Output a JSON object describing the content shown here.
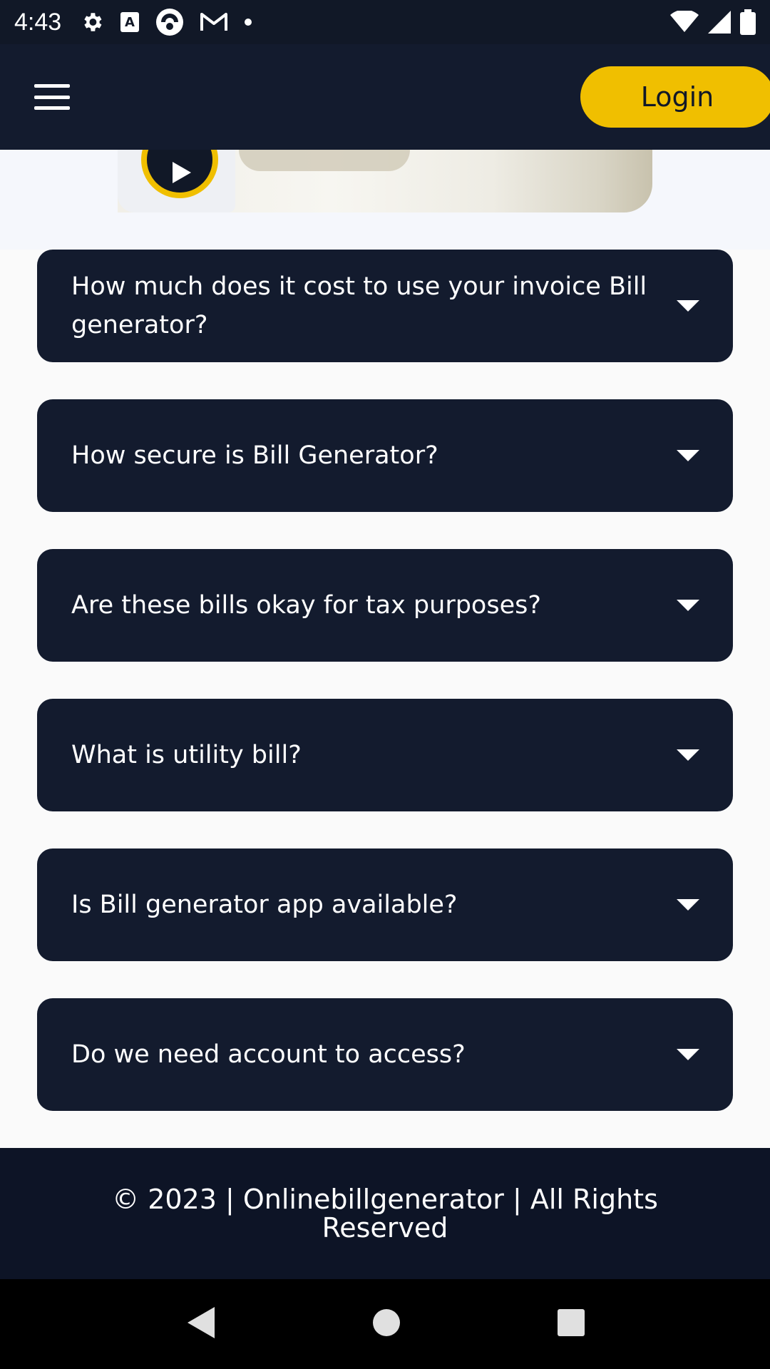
{
  "status_bar": {
    "time": "4:43",
    "left_icons": [
      "gear-icon",
      "text-a-icon",
      "app-circle-icon",
      "gmail-icon",
      "dot-icon"
    ],
    "right_icons": [
      "wifi-icon",
      "signal-icon",
      "battery-icon"
    ]
  },
  "header": {
    "menu_icon": "hamburger-menu-icon",
    "login_label": "Login",
    "accent_color": "#f0bf00",
    "background_color": "#131b2e"
  },
  "hero": {
    "play_icon": "play-icon"
  },
  "faq": {
    "items": [
      {
        "question": "How much does it cost to use your invoice Bill generator?"
      },
      {
        "question": "How secure is Bill Generator?"
      },
      {
        "question": "Are these bills okay for tax purposes?"
      },
      {
        "question": "What is utility bill?"
      },
      {
        "question": "Is Bill generator app available?"
      },
      {
        "question": "Do we need account to access?"
      }
    ]
  },
  "footer": {
    "text": "© 2023 | Onlinebillgenerator | All Rights Reserved"
  },
  "nav_bar": {
    "icons": [
      "back-icon",
      "home-icon",
      "recents-icon"
    ]
  }
}
